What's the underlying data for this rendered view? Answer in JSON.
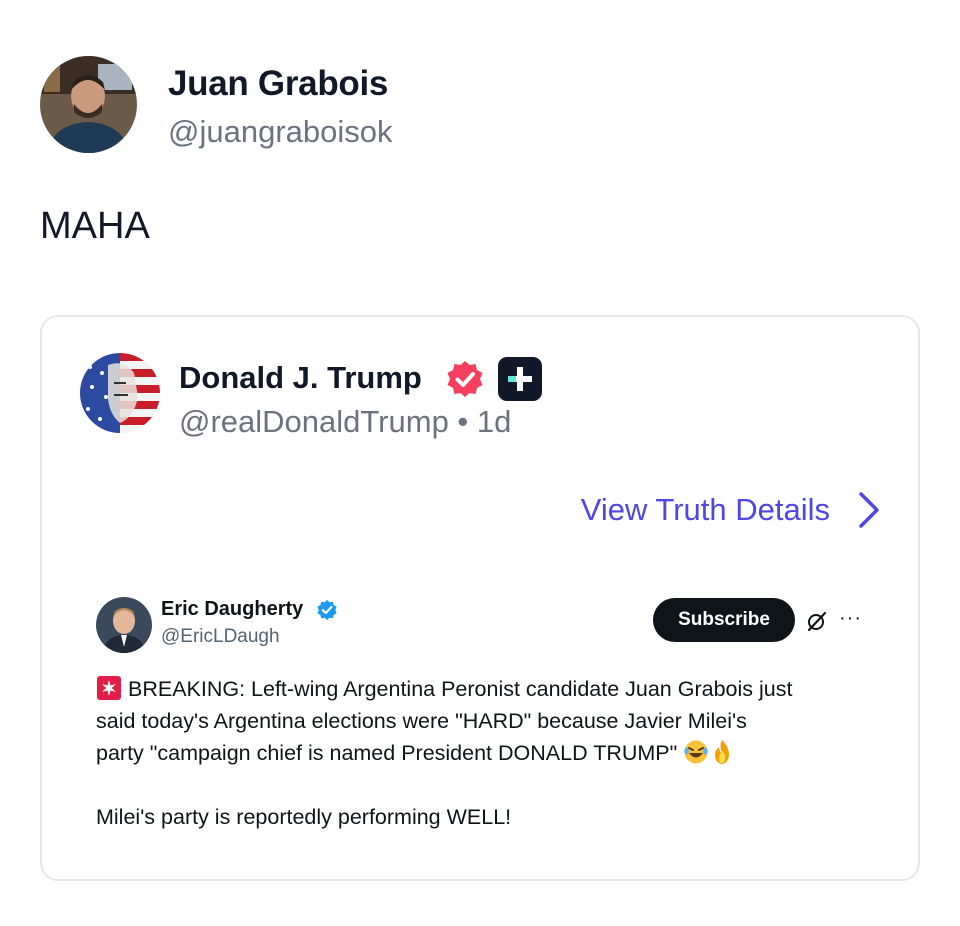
{
  "author": {
    "name": "Juan Grabois",
    "handle": "@juangraboisok"
  },
  "post": {
    "text": "MAHA"
  },
  "quoted_truth": {
    "name": "Donald J. Trump",
    "handle_line": "@realDonaldTrump • 1d",
    "view_details_label": "View Truth Details"
  },
  "embedded_x_post": {
    "name": "Eric Daugherty",
    "handle": "@EricLDaugh",
    "subscribe_label": "Subscribe",
    "more_label": "···",
    "line1": "BREAKING: Left-wing Argentina Peronist candidate Juan Grabois just",
    "line2": "said today's Argentina elections were \"HARD\" because Javier Milei's",
    "line3": "party \"campaign chief is named President DONALD TRUMP\"",
    "line4": "Milei's party is reportedly performing WELL!"
  },
  "colors": {
    "accent_link": "#4f46e5",
    "verified_truth": "#f43f5e",
    "verified_x": "#1d9bf0"
  },
  "icons": [
    "siren-emoji",
    "verified-icon",
    "plus-badge-icon",
    "chevron-right-icon",
    "grok-icon",
    "more-icon",
    "rofl-emoji",
    "fire-emoji"
  ]
}
